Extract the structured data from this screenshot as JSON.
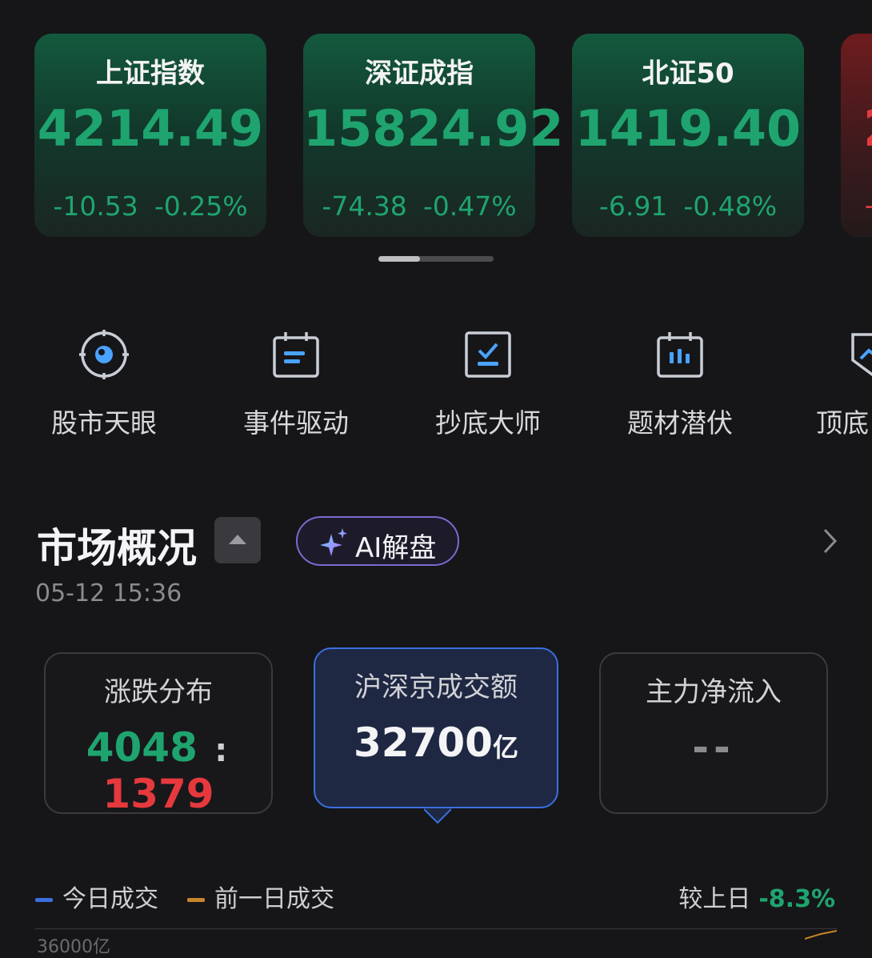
{
  "indices": [
    {
      "name": "上证指数",
      "price": "4214.49",
      "change": "-10.53",
      "pct": "-0.25%"
    },
    {
      "name": "深证成指",
      "price": "15824.92",
      "change": "-74.38",
      "pct": "-0.47%"
    },
    {
      "name": "北证50",
      "price": "1419.40",
      "change": "-6.91",
      "pct": "-0.48%"
    },
    {
      "name": "",
      "price": "2",
      "change": "+",
      "pct": ""
    }
  ],
  "features": [
    {
      "label": "股市天眼",
      "icon": "eye-target-icon"
    },
    {
      "label": "事件驱动",
      "icon": "calendar-event-icon"
    },
    {
      "label": "抄底大师",
      "icon": "checkbox-chart-icon"
    },
    {
      "label": "题材潜伏",
      "icon": "calendar-candles-icon"
    },
    {
      "label": "顶底",
      "icon": "shield-chart-icon"
    }
  ],
  "market": {
    "title": "市场概况",
    "ai_label": "AI解盘",
    "timestamp": "05-12  15:36",
    "cards": [
      {
        "label": "涨跌分布",
        "up": "4048",
        "sep": ":",
        "down": "1379"
      },
      {
        "label": "沪深京成交额",
        "value": "32700",
        "unit": "亿"
      },
      {
        "label": "主力净流入",
        "value": "--"
      }
    ]
  },
  "legend": {
    "today": "今日成交",
    "prev": "前一日成交",
    "today_color": "#3b6fe0",
    "prev_color": "#c7862a"
  },
  "compare": {
    "label": "较上日",
    "pct": "-8.3%"
  },
  "chart_axis_label": "36000亿"
}
